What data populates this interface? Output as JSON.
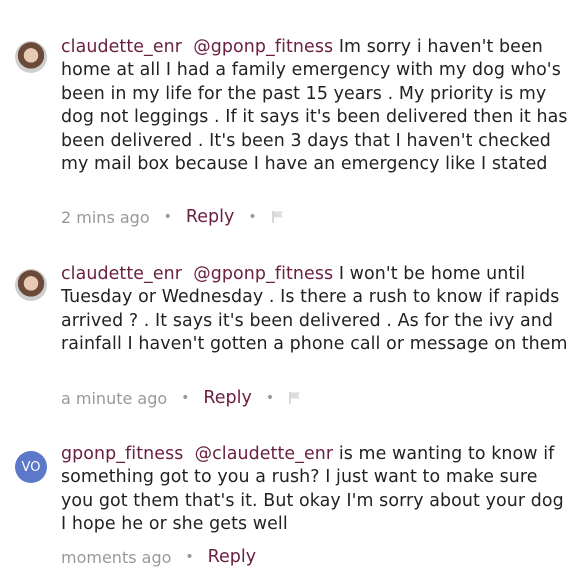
{
  "comments": [
    {
      "username": "claudette_enr",
      "mention": "@gponp_fitness",
      "text": "Im sorry i haven't been home at all I had a family emergency with my dog who's been in my life for the past 15 years . My priority is my dog not leggings . If it says it's been delivered then it has been delivered . It's been 3 days that I haven't checked my mail box because I have an emergency like I stated",
      "time": "2 mins ago",
      "reply_label": "Reply",
      "avatar_icon": "user-photo-avatar-icon",
      "has_flag": true
    },
    {
      "username": "claudette_enr",
      "mention": "@gponp_fitness",
      "text": "I won't be home until Tuesday or Wednesday . Is there a rush to know if rapids arrived ? . It says it's been delivered . As for the ivy and rainfall I haven't gotten a phone call or message on them",
      "time": "a minute ago",
      "reply_label": "Reply",
      "avatar_icon": "user-photo-avatar-icon",
      "has_flag": true
    },
    {
      "username": "gponp_fitness",
      "mention": "@claudette_enr",
      "text": "is me wanting to know if something got to you a rush? I just want to make sure you got them that's it. But okay I'm sorry about your dog I hope he or she gets well",
      "time": "moments ago",
      "reply_label": "Reply",
      "avatar_initials": "VO",
      "has_flag": false
    }
  ],
  "colors": {
    "username": "#6a2040",
    "meta": "#999999",
    "avatar_initials_bg": "#5b78c9"
  }
}
